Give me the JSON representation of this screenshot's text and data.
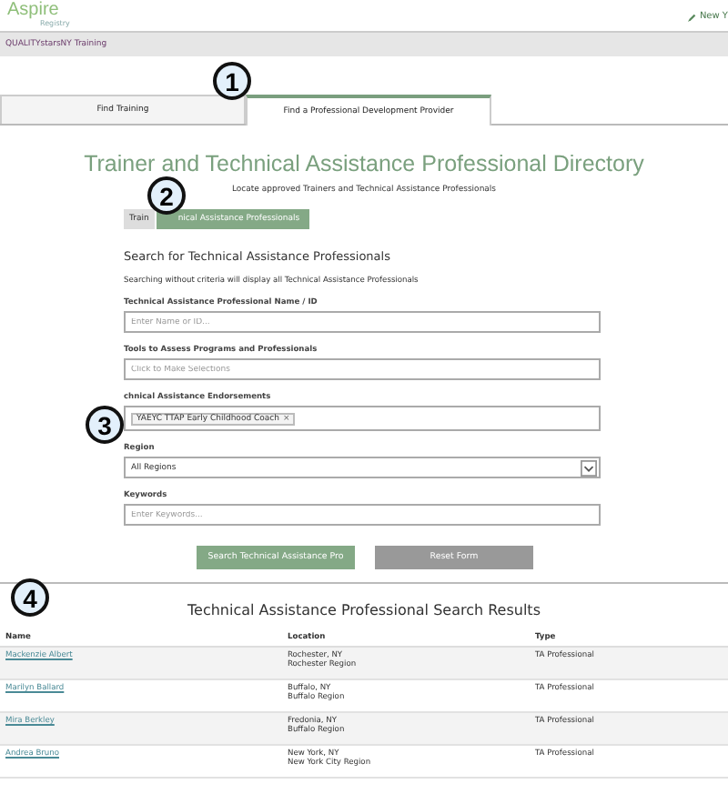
{
  "header": {
    "logo": "Aspire",
    "logo_sub": "Registry",
    "link": "New Y"
  },
  "breadcrumb": "QUALITYstarsNY Training",
  "tabs": [
    {
      "label": "Find Training",
      "selected": false
    },
    {
      "label": "Find a Professional Development Provider",
      "selected": true
    }
  ],
  "title": "Trainer and Technical Assistance Professional Directory",
  "subtitle": "Locate approved Trainers and Technical Assistance Professionals",
  "toggle": [
    {
      "label": "Train",
      "selected": false
    },
    {
      "label": "nical Assistance Professionals",
      "selected": true
    }
  ],
  "search": {
    "heading": "Search for Technical Assistance Professionals",
    "note": "Searching without criteria will display all Technical Assistance Professionals",
    "fields": [
      {
        "kind": "text",
        "label": "Technical Assistance Professional Name / ID",
        "placeholder": "Enter Name or ID..."
      },
      {
        "kind": "text",
        "label": "Tools to Assess Programs and Professionals",
        "placeholder": "Click to Make Selections"
      },
      {
        "kind": "chips",
        "label": "chnical Assistance Endorsements",
        "chips": [
          "YAEYC TTAP Early Childhood Coach"
        ],
        "chip_close": "×"
      },
      {
        "kind": "select",
        "label": "Region",
        "value": "All Regions"
      },
      {
        "kind": "text",
        "label": "Keywords",
        "placeholder": "Enter Keywords..."
      }
    ],
    "buttons": [
      {
        "kind": "primary",
        "label": "Search Technical Assistance Pro"
      },
      {
        "kind": "secondary",
        "label": "Reset Form"
      }
    ]
  },
  "results": {
    "title": "Technical Assistance Professional Search Results",
    "columns": [
      "Name",
      "Location",
      "Type"
    ],
    "rows": [
      {
        "name": "Mackenzie Albert",
        "location": [
          "Rochester, NY",
          "Rochester Region"
        ],
        "type": "TA Professional"
      },
      {
        "name": "Marilyn Ballard",
        "location": [
          "Buffalo, NY",
          "Buffalo Region"
        ],
        "type": "TA Professional"
      },
      {
        "name": "Mira Berkley",
        "location": [
          "Fredonia, NY",
          "Buffalo Region"
        ],
        "type": "TA Professional"
      },
      {
        "name": "Andrea Bruno",
        "location": [
          "New York, NY",
          "New York City Region"
        ],
        "type": "TA Professional"
      }
    ]
  },
  "callouts": [
    "1",
    "2",
    "3",
    "4"
  ]
}
